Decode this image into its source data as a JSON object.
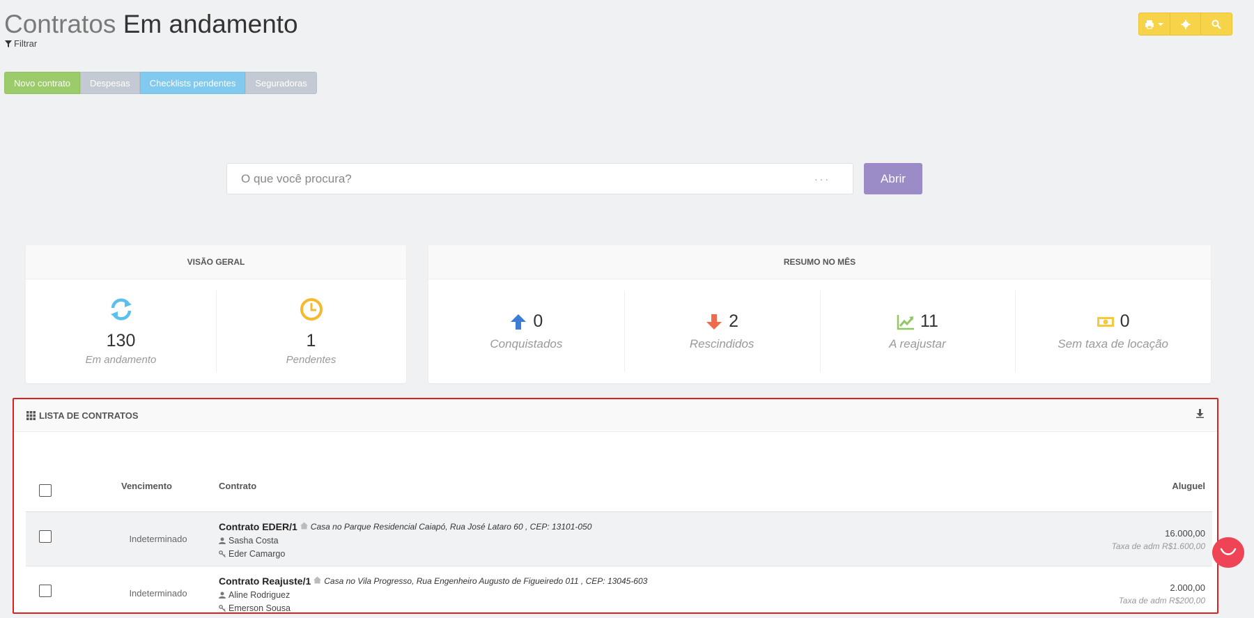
{
  "header": {
    "title_part1": "Contratos",
    "title_part2": "Em andamento",
    "filter_label": "Filtrar",
    "icons": [
      "print-icon",
      "settings-icon",
      "search-icon"
    ]
  },
  "actions": {
    "novo_contrato": "Novo contrato",
    "despesas": "Despesas",
    "checklists": "Checklists pendentes",
    "seguradoras": "Seguradoras"
  },
  "search": {
    "placeholder": "O que você procura?",
    "dots": "···",
    "button": "Abrir"
  },
  "visao_geral": {
    "title": "VISÃO GERAL",
    "stats": [
      {
        "value": "130",
        "label": "Em andamento",
        "icon": "refresh-icon",
        "color": "#5bc0eb"
      },
      {
        "value": "1",
        "label": "Pendentes",
        "icon": "clock-icon",
        "color": "#f5b82e"
      }
    ]
  },
  "resumo": {
    "title": "RESUMO NO MÊS",
    "stats": [
      {
        "value": "0",
        "label": "Conquistados",
        "icon": "arrow-up-icon",
        "color": "#3d7dd4"
      },
      {
        "value": "2",
        "label": "Rescindidos",
        "icon": "arrow-down-icon",
        "color": "#ee6b4d"
      },
      {
        "value": "11",
        "label": "A reajustar",
        "icon": "chart-line-icon",
        "color": "#8fc763"
      },
      {
        "value": "0",
        "label": "Sem taxa de locação",
        "icon": "money-icon",
        "color": "#f5c93a"
      }
    ]
  },
  "lista": {
    "title": "LISTA DE CONTRATOS",
    "columns": {
      "vencimento": "Vencimento",
      "contrato": "Contrato",
      "aluguel": "Aluguel"
    },
    "rows": [
      {
        "vencimento": "Indeterminado",
        "contrato": "Contrato EDER/1",
        "endereco": "Casa no Parque Residencial Caiapó, Rua José Lataro 60 , CEP: 13101-050",
        "inquilino": "Sasha Costa",
        "proprietario": "Eder Camargo",
        "aluguel": "16.000,00",
        "taxa": "Taxa de adm R$1.600,00"
      },
      {
        "vencimento": "Indeterminado",
        "contrato": "Contrato Reajuste/1",
        "endereco": "Casa no Vila Progresso, Rua Engenheiro Augusto de Figueiredo 011 , CEP: 13045-603",
        "inquilino": "Aline Rodriguez",
        "proprietario": "Emerson Sousa",
        "aluguel": "2.000,00",
        "taxa": "Taxa de adm R$200,00"
      }
    ]
  },
  "colors": {
    "green": "#9ccb6b",
    "gray": "#c3cad3",
    "blue": "#81c9ee",
    "purple": "#9b8bc7",
    "yellow": "#f7d34a",
    "highlight_border": "#e02020",
    "chat": "#ee4455"
  }
}
